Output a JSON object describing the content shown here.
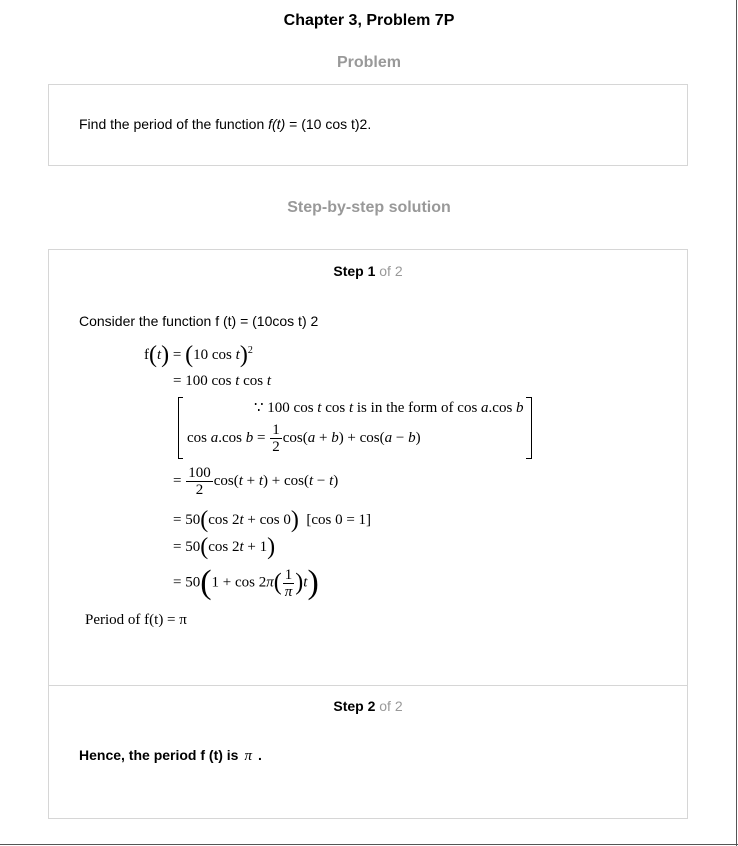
{
  "page_title": "Chapter 3, Problem 7P",
  "problem": {
    "heading": "Problem",
    "text_prefix": "Find the period of the function ",
    "text_func": "f(t)",
    "text_suffix": " = (10 cos t)2."
  },
  "solution": {
    "heading": "Step-by-step solution",
    "step1": {
      "label": "Step 1",
      "of": "of 2",
      "intro": "Consider the function f (t) = (10cos t) 2",
      "period_line": "Period of f(t) = π"
    },
    "step2": {
      "label": "Step 2",
      "of": "of 2",
      "answer_prefix": "Hence, the period f (t) is",
      "answer_value": "π",
      "answer_suffix": "."
    }
  }
}
